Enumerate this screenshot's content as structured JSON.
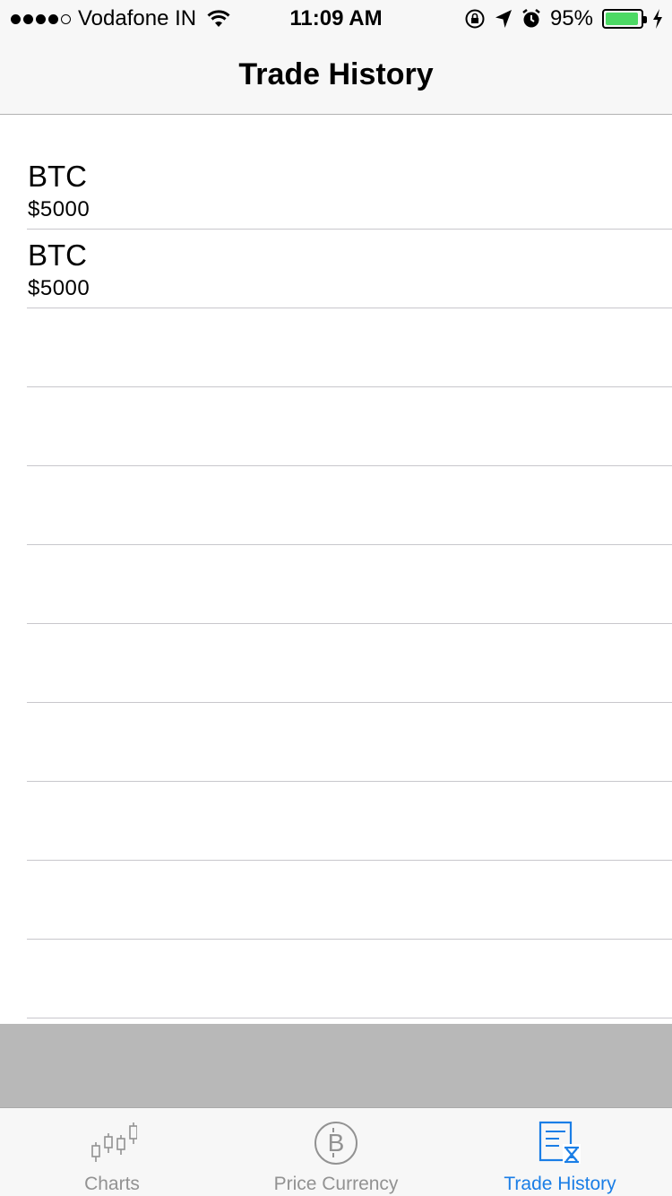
{
  "status_bar": {
    "carrier": "Vodafone IN",
    "time": "11:09 AM",
    "battery_percent": "95%",
    "signal_bars": 4,
    "signal_total": 5,
    "battery_level": 0.95,
    "battery_color": "#4cd964"
  },
  "nav": {
    "title": "Trade History"
  },
  "trades": [
    {
      "symbol": "BTC",
      "price": "$5000"
    },
    {
      "symbol": "BTC",
      "price": "$5000"
    },
    {
      "symbol": "",
      "price": ""
    },
    {
      "symbol": "",
      "price": ""
    },
    {
      "symbol": "",
      "price": ""
    },
    {
      "symbol": "",
      "price": ""
    },
    {
      "symbol": "",
      "price": ""
    },
    {
      "symbol": "",
      "price": ""
    },
    {
      "symbol": "",
      "price": ""
    },
    {
      "symbol": "",
      "price": ""
    },
    {
      "symbol": "",
      "price": ""
    }
  ],
  "tab_bar": {
    "active_color": "#1a7ee6",
    "inactive_color": "#929292",
    "tabs": [
      {
        "label": "Charts",
        "icon": "candlestick-chart-icon",
        "active": false
      },
      {
        "label": "Price Currency",
        "icon": "bitcoin-icon",
        "active": false
      },
      {
        "label": "Trade History",
        "icon": "document-hourglass-icon",
        "active": true
      }
    ]
  }
}
